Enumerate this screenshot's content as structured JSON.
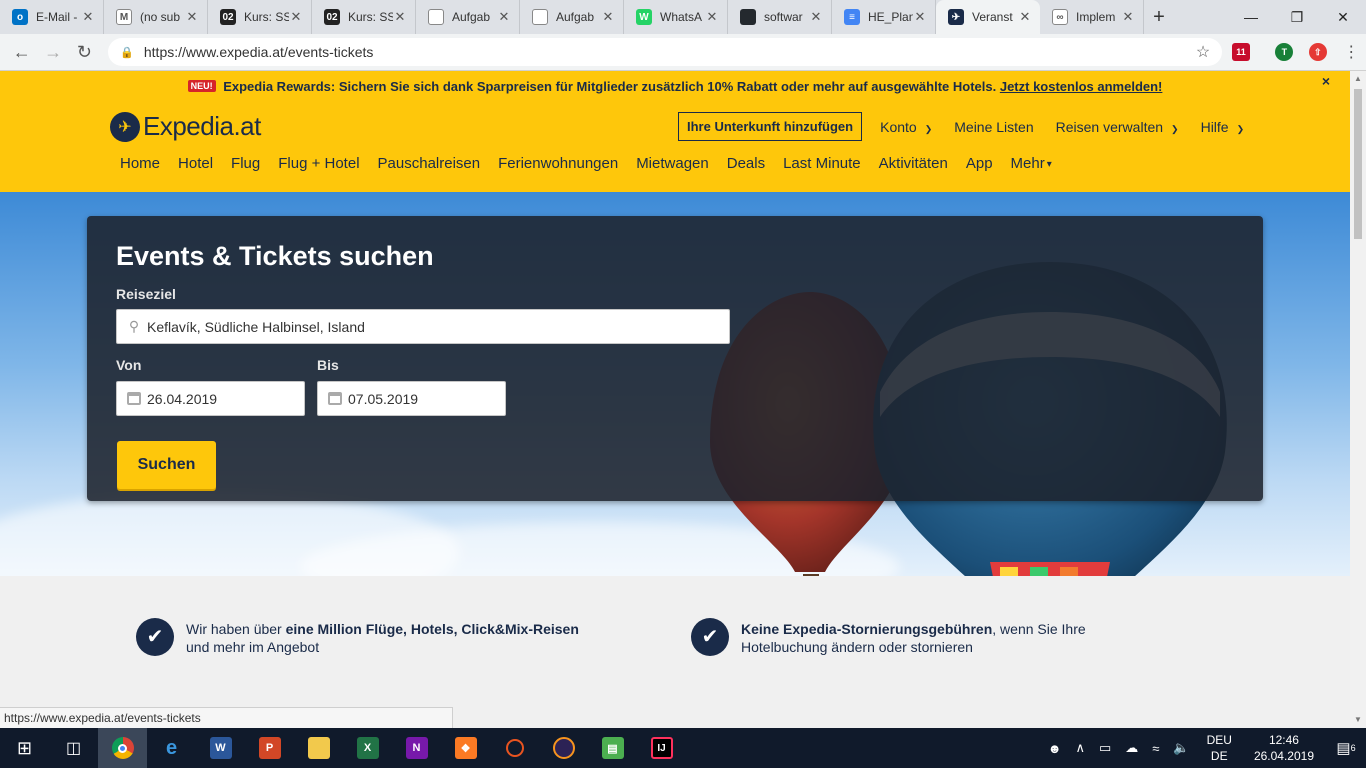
{
  "browser": {
    "tabs": [
      {
        "label": "E-Mail -",
        "icon": "outlook-icon",
        "color": "#0072c6",
        "glyph": "o"
      },
      {
        "label": "(no sub",
        "icon": "gmail-icon",
        "color": "#ffffff",
        "glyph": "M"
      },
      {
        "label": "Kurs: SS",
        "icon": "moodle-02-icon",
        "color": "#222222",
        "glyph": "02"
      },
      {
        "label": "Kurs: SS",
        "icon": "moodle-02-icon",
        "color": "#222222",
        "glyph": "02"
      },
      {
        "label": "Aufgab",
        "icon": "document-icon",
        "color": "#ffffff",
        "glyph": ""
      },
      {
        "label": "Aufgab",
        "icon": "document-icon",
        "color": "#ffffff",
        "glyph": ""
      },
      {
        "label": "WhatsA",
        "icon": "whatsapp-icon",
        "color": "#25d366",
        "glyph": "W"
      },
      {
        "label": "softwar",
        "icon": "github-icon",
        "color": "#24292e",
        "glyph": ""
      },
      {
        "label": "HE_Plan",
        "icon": "google-docs-icon",
        "color": "#4285f4",
        "glyph": "≡"
      },
      {
        "label": "Veranst",
        "icon": "expedia-icon",
        "color": "#1a2b49",
        "glyph": "✈",
        "active": true
      },
      {
        "label": "Implem",
        "icon": "overleaf-icon",
        "color": "#ffffff",
        "glyph": "∞"
      }
    ],
    "url": "https://www.expedia.at/events-tickets",
    "status_url": "https://www.expedia.at/events-tickets",
    "ext_badge": "11",
    "profile_initial": "T"
  },
  "promo": {
    "badge": "NEU!",
    "text": "Expedia Rewards: Sichern Sie sich dank Sparpreisen für Mitglieder zusätzlich 10% Rabatt oder mehr auf ausgewählte Hotels.",
    "link": "Jetzt kostenlos anmelden!",
    "close": "×"
  },
  "header": {
    "logo_text": "Expedia.at",
    "add_property": "Ihre Unterkunft hinzufügen",
    "account": "Konto",
    "lists": "Meine Listen",
    "manage_trips": "Reisen verwalten",
    "help": "Hilfe"
  },
  "nav": [
    "Home",
    "Hotel",
    "Flug",
    "Flug + Hotel",
    "Pauschalreisen",
    "Ferienwohnungen",
    "Mietwagen",
    "Deals",
    "Last Minute",
    "Aktivitäten",
    "App",
    "Mehr"
  ],
  "search": {
    "title": "Events & Tickets suchen",
    "destination_label": "Reiseziel",
    "destination_value": "Keflavík, Südliche Halbinsel, Island",
    "from_label": "Von",
    "from_value": "26.04.2019",
    "to_label": "Bis",
    "to_value": "07.05.2019",
    "button": "Suchen"
  },
  "benefits": [
    {
      "pre": "Wir haben über ",
      "bold": "eine Million Flüge, Hotels, Click&Mix-Reisen",
      "post": "",
      "line2": "und mehr im Angebot"
    },
    {
      "pre": "",
      "bold": "Keine Expedia-Stornierungsgebühren",
      "post": ", wenn Sie Ihre",
      "line2": "Hotelbuchung ändern oder stornieren"
    }
  ],
  "taskbar": {
    "lang_top": "DEU",
    "lang_bottom": "DE",
    "time": "12:46",
    "date": "26.04.2019",
    "notif_count": "6"
  }
}
